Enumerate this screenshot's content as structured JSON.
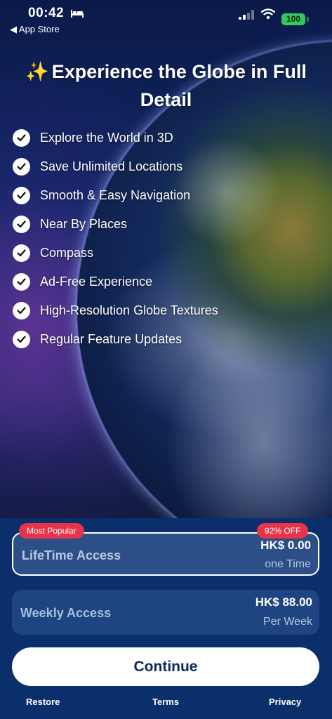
{
  "status_bar": {
    "time": "00:42",
    "back_label": "◀ App Store",
    "battery": "100",
    "icons": [
      "bed-icon",
      "signal-icon",
      "wifi-icon",
      "battery-icon"
    ]
  },
  "headline": {
    "sparkle": "✨",
    "text": "Experience the Globe in Full Detail"
  },
  "features": [
    "Explore the World in 3D",
    "Save Unlimited Locations",
    "Smooth & Easy Navigation",
    "Near By Places",
    "Compass",
    "Ad-Free Experience",
    "High-Resolution Globe Textures",
    "Regular Feature Updates"
  ],
  "plans": {
    "lifetime": {
      "badge": "Most Popular",
      "discount": "92% OFF",
      "name": "LifeTime Access",
      "price": "HK$ 0.00",
      "period": "one Time",
      "selected": true
    },
    "weekly": {
      "name": "Weekly Access",
      "price": "HK$ 88.00",
      "period": "Per Week",
      "selected": false
    }
  },
  "actions": {
    "continue": "Continue",
    "restore": "Restore",
    "terms": "Terms",
    "privacy": "Privacy"
  },
  "colors": {
    "accent_badge": "#e8344b",
    "battery": "#34c759",
    "panel": "#0a2f6b",
    "button_text": "#0b2a5c"
  }
}
